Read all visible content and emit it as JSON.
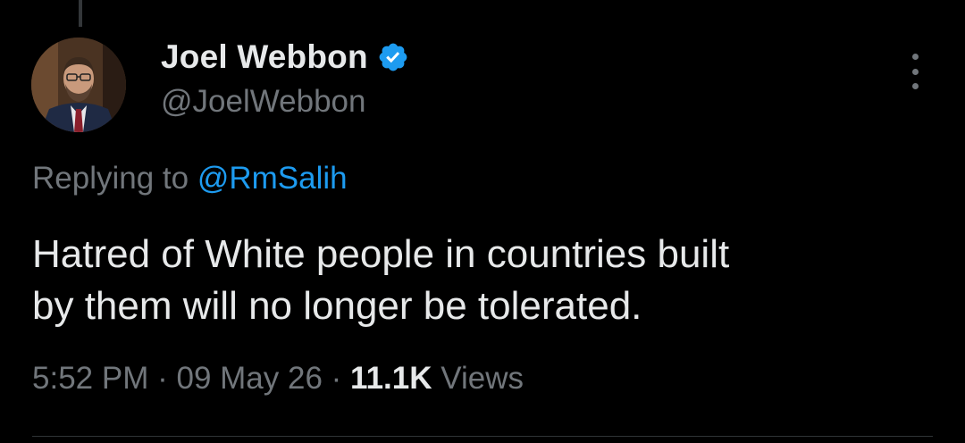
{
  "author": {
    "display_name": "Joel Webbon",
    "handle": "@JoelWebbon",
    "verified": true,
    "verified_color": "#1d9bf0"
  },
  "reply": {
    "prefix": "Replying to",
    "mention": "@RmSalih"
  },
  "tweet": {
    "text_line1": "Hatred of White people in countries built",
    "text_line2": "by them will no longer be tolerated."
  },
  "meta": {
    "time": "5:52 PM",
    "separator": "·",
    "date": "09 May 26",
    "views_count": "11.1K",
    "views_label": "Views"
  },
  "icons": {
    "more": "more-vertical-icon",
    "verified": "verified-badge-icon"
  },
  "colors": {
    "background": "#000000",
    "primary_text": "#e7e9ea",
    "secondary_text": "#71767b",
    "accent": "#1d9bf0"
  }
}
